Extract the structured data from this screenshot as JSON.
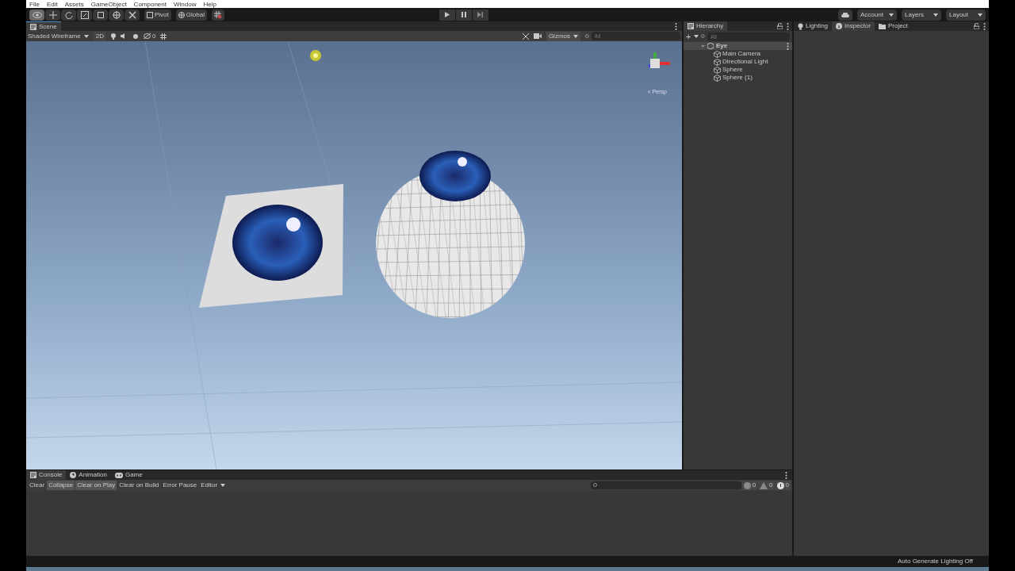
{
  "menu": [
    "File",
    "Edit",
    "Assets",
    "GameObject",
    "Component",
    "Window",
    "Help"
  ],
  "toolbar": {
    "tools": [
      {
        "selected": true
      },
      {
        "selected": false
      },
      {
        "selected": false
      },
      {
        "selected": false
      },
      {
        "selected": false
      },
      {
        "selected": false
      },
      {
        "selected": false
      }
    ],
    "pivot": "Pivot",
    "global": "Global",
    "right": [
      "Account",
      "Layers",
      "Layout"
    ]
  },
  "scene": {
    "tab": "Scene",
    "draw_mode": "Shaded Wireframe",
    "mode_2d": "2D",
    "hidden_count": "0",
    "gizmos": "Gizmos",
    "search_placeholder": "All",
    "projection": "< Persp"
  },
  "hierarchy": {
    "tab": "Hierarchy",
    "add": "+",
    "search_placeholder": "All",
    "root": {
      "name": "Eye",
      "expanded": true,
      "children": [
        {
          "name": "Main Camera"
        },
        {
          "name": "Directional Light"
        },
        {
          "name": "Sphere"
        },
        {
          "name": "Sphere (1)"
        }
      ]
    }
  },
  "inspector_tabs": [
    {
      "label": "Lighting",
      "selected": false
    },
    {
      "label": "Inspector",
      "selected": true
    },
    {
      "label": "Project",
      "selected": false
    }
  ],
  "console": {
    "tabs": [
      {
        "label": "Console",
        "selected": true
      },
      {
        "label": "Animation",
        "selected": false
      },
      {
        "label": "Game",
        "selected": false
      }
    ],
    "buttons": [
      {
        "label": "Clear",
        "on": false
      },
      {
        "label": "Collapse",
        "on": true
      },
      {
        "label": "Clear on Play",
        "on": true
      },
      {
        "label": "Clear on Build",
        "on": false
      },
      {
        "label": "Error Pause",
        "on": false
      }
    ],
    "editor": "Editor",
    "counts": [
      {
        "kind": "info",
        "value": "0"
      },
      {
        "kind": "warning",
        "value": "0"
      },
      {
        "kind": "error",
        "value": "0"
      }
    ]
  },
  "status": "Auto Generate Lighting Off"
}
